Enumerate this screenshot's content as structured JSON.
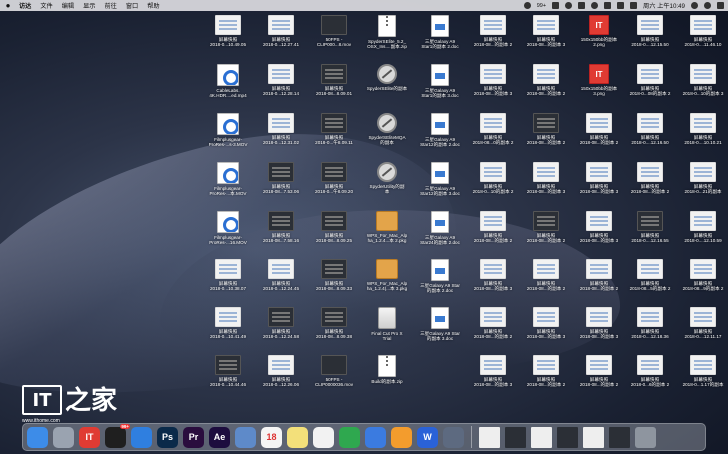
{
  "menubar": {
    "items": [
      "访达",
      "文件",
      "编辑",
      "显示",
      "前往",
      "窗口",
      "帮助"
    ],
    "badge": "99+",
    "clock": "周六 上午10:49"
  },
  "desktop_icons": [
    {
      "label": "屏幕快照\n2018-0...10.49.05",
      "kind": "screenshot",
      "col": 0,
      "row": 0
    },
    {
      "label": "屏幕快照\n2018-0...12.27.41",
      "kind": "screenshot",
      "col": 1,
      "row": 0
    },
    {
      "label": "50FPS -\nCLIP000...8.mov",
      "kind": "video-dark",
      "col": 2,
      "row": 0
    },
    {
      "label": "SpyderSElite_5.2_\nOSX_Ins....副本.zip",
      "kind": "zip",
      "col": 3,
      "row": 0
    },
    {
      "label": "三星Galaxy A9\nStar1的副本 2.doc",
      "kind": "doc",
      "col": 4,
      "row": 0
    },
    {
      "label": "屏幕快照\n2018-08...的副本 2",
      "kind": "screenshot",
      "col": 5,
      "row": 0
    },
    {
      "label": "屏幕快照\n2018-08...的副本 3",
      "kind": "screenshot",
      "col": 6,
      "row": 0
    },
    {
      "label": "150x150bb的副本\n2.png",
      "kind": "red-logo",
      "col": 7,
      "row": 0
    },
    {
      "label": "屏幕快照\n2018-0....12.15.50",
      "kind": "screenshot",
      "col": 8,
      "row": 0
    },
    {
      "label": "屏幕快照\n2018-0....11.46.10",
      "kind": "screenshot",
      "col": 9,
      "row": 0
    },
    {
      "label": "CableLabs.\n4K.HDR....ed.mp4",
      "kind": "quicktime",
      "col": 0,
      "row": 1
    },
    {
      "label": "屏幕快照\n2018-0...12.28.14",
      "kind": "screenshot",
      "col": 1,
      "row": 1
    },
    {
      "label": "屏幕快照\n2018-08...8.09.01",
      "kind": "screenshot-dark",
      "col": 2,
      "row": 1
    },
    {
      "label": "SpyderSElite的副本",
      "kind": "blocked",
      "col": 3,
      "row": 1
    },
    {
      "label": "三星Galaxy A9\nStar1的副本 3.doc",
      "kind": "doc",
      "col": 4,
      "row": 1
    },
    {
      "label": "屏幕快照\n2018-08...的副本 3",
      "kind": "screenshot",
      "col": 5,
      "row": 1
    },
    {
      "label": "屏幕快照\n2018-08...的副本 2",
      "kind": "screenshot",
      "col": 6,
      "row": 1
    },
    {
      "label": "150x150bb的副本\n3.png",
      "kind": "red-logo",
      "col": 7,
      "row": 1
    },
    {
      "label": "屏幕快照\n2018-0...08的副本 2",
      "kind": "screenshot",
      "col": 8,
      "row": 1
    },
    {
      "label": "屏幕快照\n2018-0...10的副本 3",
      "kind": "screenshot",
      "col": 9,
      "row": 1
    },
    {
      "label": "Filmplusgear-\nProRes-...s-3.MOV",
      "kind": "quicktime",
      "col": 0,
      "row": 2
    },
    {
      "label": "屏幕快照\n2018-0...12.31.02",
      "kind": "screenshot",
      "col": 1,
      "row": 2
    },
    {
      "label": "屏幕快照\n2018-0...午8.09.11",
      "kind": "screenshot-dark",
      "col": 2,
      "row": 2
    },
    {
      "label": "SpyderSEliteMQA\n的副本",
      "kind": "blocked",
      "col": 3,
      "row": 2
    },
    {
      "label": "三星Galaxy A9\nStar12的副本 2.doc",
      "kind": "doc",
      "col": 4,
      "row": 2
    },
    {
      "label": "屏幕快照\n2018-08...0的副本 2",
      "kind": "screenshot",
      "col": 5,
      "row": 2
    },
    {
      "label": "屏幕快照\n2018-08...的副本 2",
      "kind": "screenshot-dark",
      "col": 6,
      "row": 2
    },
    {
      "label": "屏幕快照\n2018-08...的副本 2",
      "kind": "screenshot",
      "col": 7,
      "row": 2
    },
    {
      "label": "屏幕快照\n2018-0....12.16.50",
      "kind": "screenshot",
      "col": 8,
      "row": 2
    },
    {
      "label": "屏幕快照\n2018-0....10.10.21",
      "kind": "screenshot",
      "col": 9,
      "row": 2
    },
    {
      "label": "Filmplusgear-\nProRes-...本.MOV",
      "kind": "quicktime",
      "col": 0,
      "row": 3
    },
    {
      "label": "屏幕快照\n2018-08...7.53.06",
      "kind": "screenshot-dark",
      "col": 1,
      "row": 3
    },
    {
      "label": "屏幕快照\n2018-0...午8.09.20",
      "kind": "screenshot-dark",
      "col": 2,
      "row": 3
    },
    {
      "label": "SpyderUtility的副\n本",
      "kind": "blocked",
      "col": 3,
      "row": 3
    },
    {
      "label": "三星Galaxy A9\nStar12的副本 3.doc",
      "kind": "doc",
      "col": 4,
      "row": 3
    },
    {
      "label": "屏幕快照\n2018-0...10的副本 2",
      "kind": "screenshot",
      "col": 5,
      "row": 3
    },
    {
      "label": "屏幕快照\n2018-08...的副本 3",
      "kind": "screenshot",
      "col": 6,
      "row": 3
    },
    {
      "label": "屏幕快照\n2018-08...的副本 3",
      "kind": "screenshot",
      "col": 7,
      "row": 3
    },
    {
      "label": "屏幕快照\n2018-08...的副本 2",
      "kind": "screenshot",
      "col": 8,
      "row": 3
    },
    {
      "label": "屏幕快照\n2018-0...21的副本",
      "kind": "screenshot",
      "col": 9,
      "row": 3
    },
    {
      "label": "Filmplusgear-\nProRes-...16.MOV",
      "kind": "quicktime",
      "col": 0,
      "row": 4
    },
    {
      "label": "屏幕快照\n2018-08...7.58.16",
      "kind": "screenshot-dark",
      "col": 1,
      "row": 4
    },
    {
      "label": "屏幕快照\n2018-08...8.09.25",
      "kind": "screenshot-dark",
      "col": 2,
      "row": 4
    },
    {
      "label": "WPS_For_Mac_Alp\nha_1.2.4...本 2.pkg",
      "kind": "package",
      "col": 3,
      "row": 4
    },
    {
      "label": "三星Galaxy A9\nStar24的副本 2.doc",
      "kind": "doc",
      "col": 4,
      "row": 4
    },
    {
      "label": "屏幕快照\n2018-08...的副本 2",
      "kind": "screenshot",
      "col": 5,
      "row": 4
    },
    {
      "label": "屏幕快照\n2018-08...的副本 2",
      "kind": "screenshot-dark",
      "col": 6,
      "row": 4
    },
    {
      "label": "屏幕快照\n2018-08...的副本 3",
      "kind": "screenshot",
      "col": 7,
      "row": 4
    },
    {
      "label": "屏幕快照\n2018-0....12.16.55",
      "kind": "screenshot-dark",
      "col": 8,
      "row": 4
    },
    {
      "label": "屏幕快照\n2018-0....12.10.59",
      "kind": "screenshot",
      "col": 9,
      "row": 4
    },
    {
      "label": "屏幕快照\n2018-0...10.38.07",
      "kind": "screenshot",
      "col": 0,
      "row": 5
    },
    {
      "label": "屏幕快照\n2018-0...12.24.45",
      "kind": "screenshot",
      "col": 1,
      "row": 5
    },
    {
      "label": "屏幕快照\n2018-08...8.09.33",
      "kind": "screenshot-dark",
      "col": 2,
      "row": 5
    },
    {
      "label": "WPS_For_Mac_Alp\nha_1.2.4(...本 3.pkg",
      "kind": "package",
      "col": 3,
      "row": 5
    },
    {
      "label": "三星Galaxy A9 Star\n的副本 2.doc",
      "kind": "doc",
      "col": 4,
      "row": 5
    },
    {
      "label": "屏幕快照\n2018-08...的副本 3",
      "kind": "screenshot",
      "col": 5,
      "row": 5
    },
    {
      "label": "屏幕快照\n2018-08...的副本 2",
      "kind": "screenshot",
      "col": 6,
      "row": 5
    },
    {
      "label": "屏幕快照\n2018-08...的副本 2",
      "kind": "screenshot",
      "col": 7,
      "row": 5
    },
    {
      "label": "屏幕快照\n2018-08...5的副本 2",
      "kind": "screenshot",
      "col": 8,
      "row": 5
    },
    {
      "label": "屏幕快照\n2018-08...9的副本 2",
      "kind": "screenshot",
      "col": 9,
      "row": 5
    },
    {
      "label": "屏幕快照\n2018-0...10.41.49",
      "kind": "screenshot",
      "col": 0,
      "row": 6
    },
    {
      "label": "屏幕快照\n2018-0...12.24.58",
      "kind": "screenshot-dark",
      "col": 1,
      "row": 6
    },
    {
      "label": "屏幕快照\n2018-08...8.09.38",
      "kind": "screenshot-dark",
      "col": 2,
      "row": 6
    },
    {
      "label": "Final Cut Pro X\nTrial",
      "kind": "disk",
      "col": 3,
      "row": 6
    },
    {
      "label": "三星Galaxy A9 Star\n的副本 3.doc",
      "kind": "doc",
      "col": 4,
      "row": 6
    },
    {
      "label": "屏幕快照\n2018-08...的副本 2",
      "kind": "screenshot",
      "col": 5,
      "row": 6
    },
    {
      "label": "屏幕快照\n2018-08...的副本 3",
      "kind": "screenshot",
      "col": 6,
      "row": 6
    },
    {
      "label": "屏幕快照\n2018-08...的副本 3",
      "kind": "screenshot",
      "col": 7,
      "row": 6
    },
    {
      "label": "屏幕快照\n2018-0....12.18.36",
      "kind": "screenshot",
      "col": 8,
      "row": 6
    },
    {
      "label": "屏幕快照\n2018-0....12.11.17",
      "kind": "screenshot",
      "col": 9,
      "row": 6
    },
    {
      "label": "屏幕快照\n2018-0...10.44.46",
      "kind": "screenshot-dark",
      "col": 0,
      "row": 7
    },
    {
      "label": "屏幕快照\n2018-0...12.26.06",
      "kind": "screenshot",
      "col": 1,
      "row": 7
    },
    {
      "label": "50FPS -\nCLIP0000036.mov",
      "kind": "video-dark",
      "col": 2,
      "row": 7
    },
    {
      "label": "Build的副本.zip",
      "kind": "zip",
      "col": 3,
      "row": 7
    },
    {
      "label": "屏幕快照\n2018-08...的副本 3",
      "kind": "screenshot",
      "col": 5,
      "row": 7
    },
    {
      "label": "屏幕快照\n2018-08...的副本 2",
      "kind": "screenshot",
      "col": 6,
      "row": 7
    },
    {
      "label": "屏幕快照\n2018-08...的副本 2",
      "kind": "screenshot",
      "col": 7,
      "row": 7
    },
    {
      "label": "屏幕快照\n2018-0...6的副本 2",
      "kind": "screenshot",
      "col": 8,
      "row": 7
    },
    {
      "label": "屏幕快照\n2018-0...1.17的副本",
      "kind": "screenshot",
      "col": 9,
      "row": 7
    }
  ],
  "watermark": {
    "logo_text": "IT",
    "char": "之家",
    "url": "www.ithome.com"
  },
  "dock": {
    "apps": [
      {
        "name": "finder-app",
        "color": "#3d8ce8",
        "glyph": ""
      },
      {
        "name": "launchpad-app",
        "color": "#9aa3b0",
        "glyph": ""
      },
      {
        "name": "ithome-app",
        "color": "#e03b33",
        "glyph": "IT"
      },
      {
        "name": "qq-app",
        "color": "#1f1f1f",
        "glyph": "",
        "badge": "99+"
      },
      {
        "name": "safari-app",
        "color": "#2f7fe0",
        "glyph": ""
      },
      {
        "name": "photoshop-app",
        "color": "#0b2a4a",
        "glyph": "Ps"
      },
      {
        "name": "premiere-app",
        "color": "#2a0d3e",
        "glyph": "Pr"
      },
      {
        "name": "aftereffects-app",
        "color": "#1d0d3e",
        "glyph": "Ae"
      },
      {
        "name": "preview-app",
        "color": "#5e8ac9",
        "glyph": ""
      },
      {
        "name": "calendar-app",
        "color": "#f5f5f5",
        "glyph": "18"
      },
      {
        "name": "notes-app",
        "color": "#f3e07a",
        "glyph": ""
      },
      {
        "name": "photos-app",
        "color": "#f2f2f2",
        "glyph": ""
      },
      {
        "name": "numbers-app",
        "color": "#2fa84f",
        "glyph": ""
      },
      {
        "name": "keynote-app",
        "color": "#3b7be0",
        "glyph": ""
      },
      {
        "name": "pages-app",
        "color": "#f39c2d",
        "glyph": ""
      },
      {
        "name": "wps-app",
        "color": "#2a62d8",
        "glyph": "W"
      },
      {
        "name": "mail-app",
        "color": "#5d6a80",
        "glyph": ""
      }
    ],
    "recents": [
      {
        "name": "dock-doc-1",
        "color": "#eeeeee"
      },
      {
        "name": "dock-doc-2",
        "color": "#2b2f36"
      },
      {
        "name": "dock-doc-3",
        "color": "#eeeeee"
      },
      {
        "name": "dock-doc-4",
        "color": "#2b2f36"
      },
      {
        "name": "dock-doc-5",
        "color": "#eeeeee"
      },
      {
        "name": "dock-doc-6",
        "color": "#2b2f36"
      },
      {
        "name": "trash",
        "color": "#8e959f"
      }
    ]
  },
  "colors": {
    "menubar_bg": "#dcdce1",
    "label_text": "#ffffff"
  }
}
